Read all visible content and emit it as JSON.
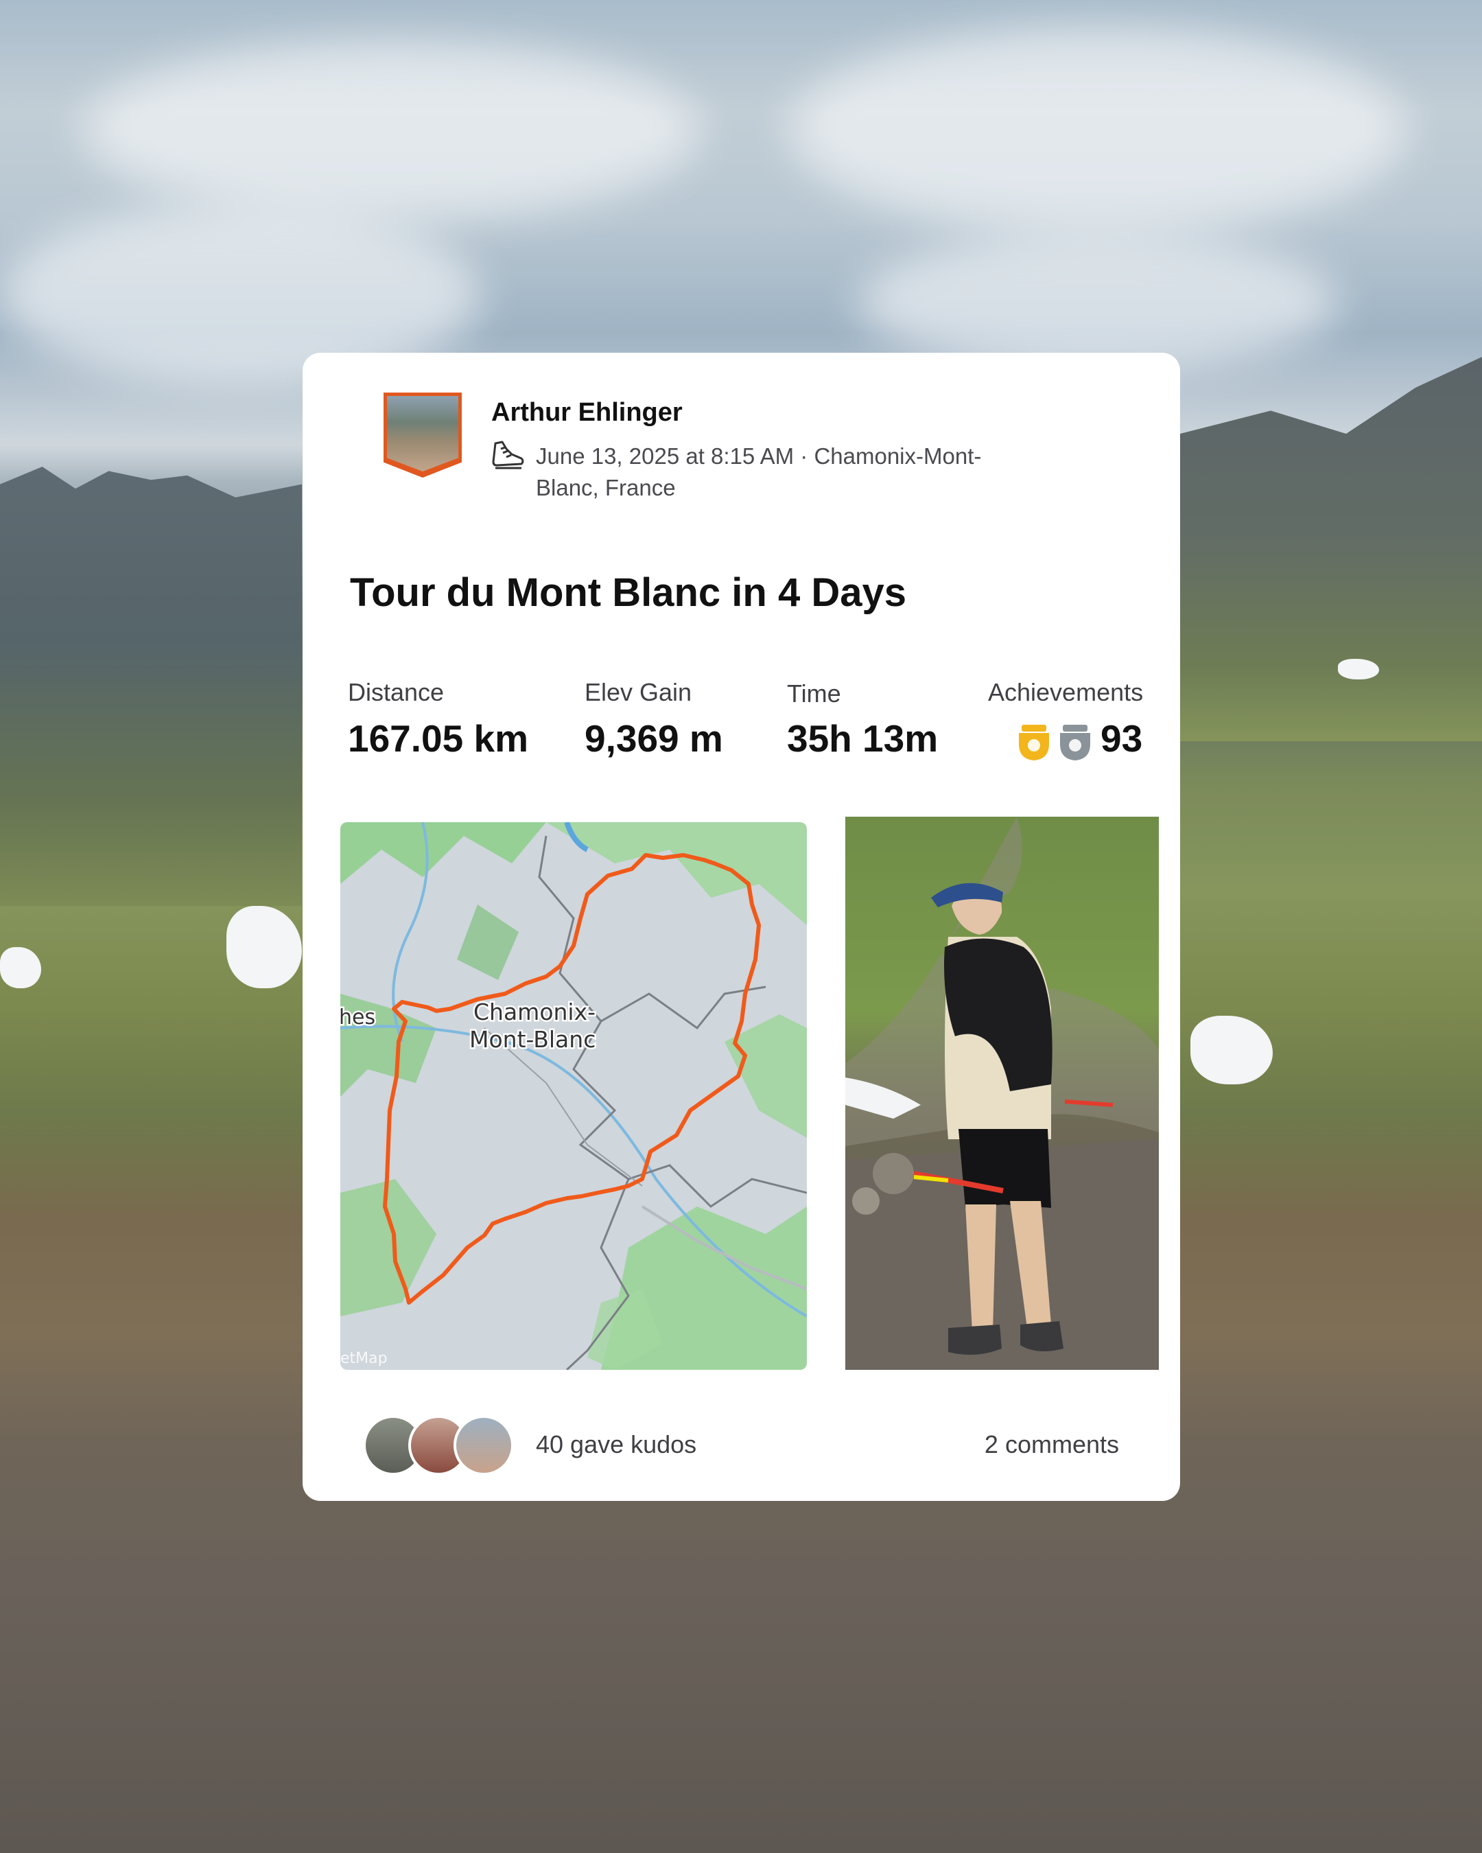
{
  "activity": {
    "athlete_name": "Arthur Ehlinger",
    "date_location": "June 13, 2025 at 8:15 AM · Chamonix-Mont-Blanc, France",
    "title": "Tour du Mont Blanc in 4 Days",
    "activity_icon": "trail-shoe-icon"
  },
  "stats": [
    {
      "label": "Distance",
      "value": "167.05 km"
    },
    {
      "label": "Elev Gain",
      "value": "9,369 m"
    },
    {
      "label": "Time",
      "value": "35h 13m"
    }
  ],
  "achievements": {
    "label": "Achievements",
    "count": "93",
    "icons": [
      "gold-trophy-icon",
      "silver-trophy-icon"
    ]
  },
  "map": {
    "labels": [
      "hes",
      "Chamonix-",
      "Mont-Blanc"
    ],
    "attribution": "etMap",
    "route_color": "#f05a1a"
  },
  "social": {
    "kudos_text": "40 gave kudos",
    "comments_text": "2 comments"
  },
  "colors": {
    "brand_orange": "#f05a1a",
    "gold": "#f2b51c",
    "silver": "#8a9399"
  }
}
